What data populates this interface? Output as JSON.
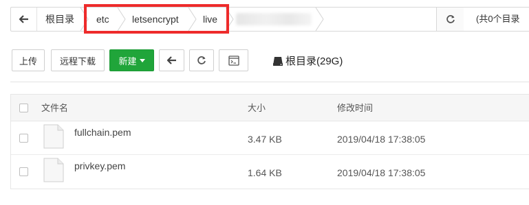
{
  "breadcrumb": {
    "root_label": "根目录",
    "segments": [
      "etc",
      "letsencrypt",
      "live"
    ],
    "count_text": "(共0个目录"
  },
  "toolbar": {
    "upload_label": "上传",
    "remote_download_label": "远程下载",
    "new_label": "新建",
    "disk_label": "根目录(29G)"
  },
  "table": {
    "headers": {
      "name": "文件名",
      "size": "大小",
      "modified": "修改时间"
    },
    "rows": [
      {
        "name": "fullchain.pem",
        "size": "3.47 KB",
        "modified": "2019/04/18 17:38:05"
      },
      {
        "name": "privkey.pem",
        "size": "1.64 KB",
        "modified": "2019/04/18 17:38:05"
      }
    ]
  },
  "colors": {
    "accent_green": "#20a53a",
    "highlight_red": "#ee2b2b"
  }
}
